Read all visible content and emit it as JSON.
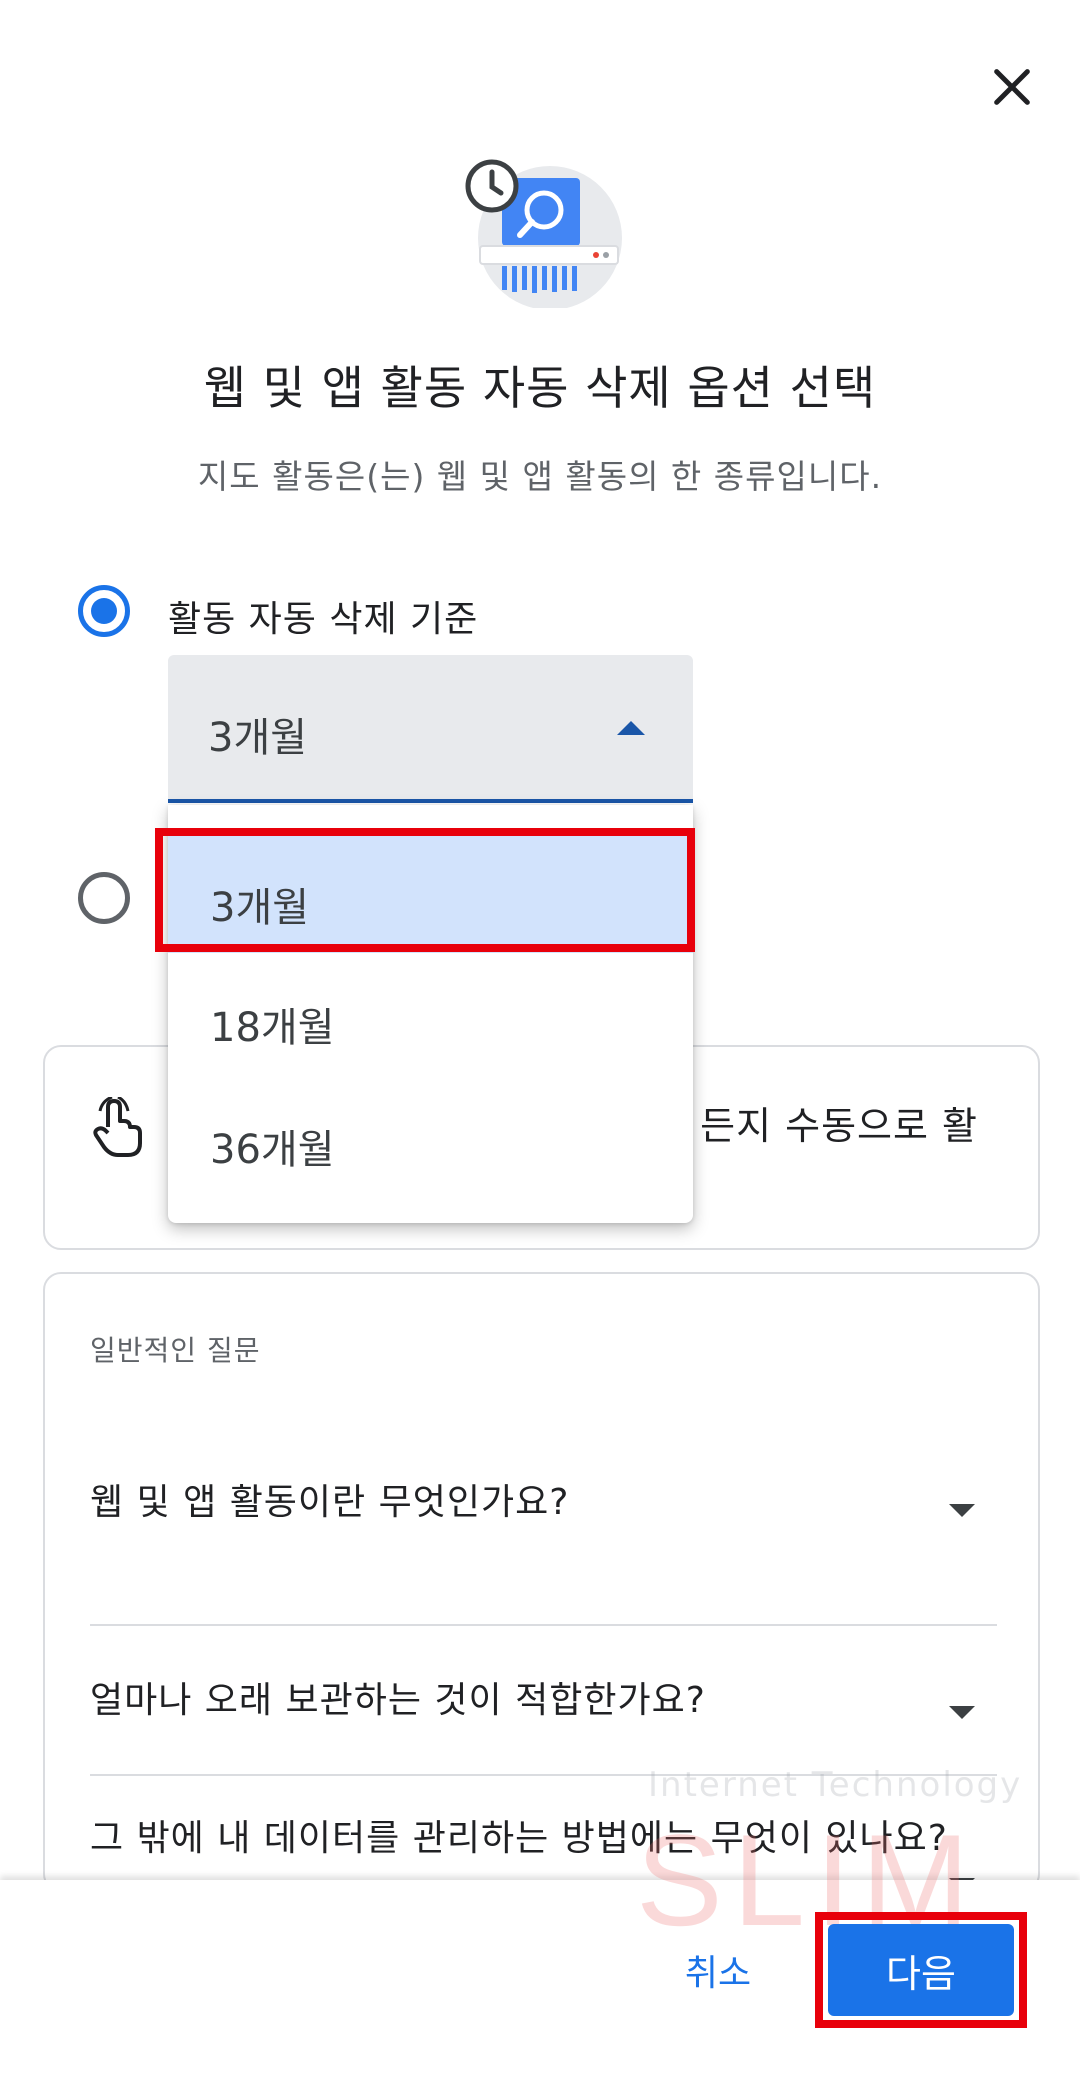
{
  "header": {
    "close_label": "×",
    "title": "웹 및 앱 활동 자동 삭제 옵션 선택",
    "subtitle": "지도 활동은(는) 웹 및 앱 활동의 한 종류입니다."
  },
  "options": {
    "auto_delete_label": "활동 자동 삭제 기준",
    "selected_period": "3개월",
    "period_options": [
      "3개월",
      "18개월",
      "36개월"
    ]
  },
  "manual_card": {
    "text": "든지 수동으로 활"
  },
  "faq": {
    "heading": "일반적인 질문",
    "items": [
      "웹 및 앱 활동이란 무엇인가요?",
      "얼마나 오래 보관하는 것이 적합한가요?",
      "그 밖에 내 데이터를 관리하는 방법에는 무엇이 있나요?"
    ]
  },
  "footer": {
    "cancel_label": "취소",
    "next_label": "다음"
  },
  "watermark": {
    "subtitle": "Internet Technology",
    "title": "SLIM"
  },
  "colors": {
    "accent": "#1a73e8",
    "highlight": "#e8000b",
    "selected_option_bg": "#d2e3fc"
  }
}
